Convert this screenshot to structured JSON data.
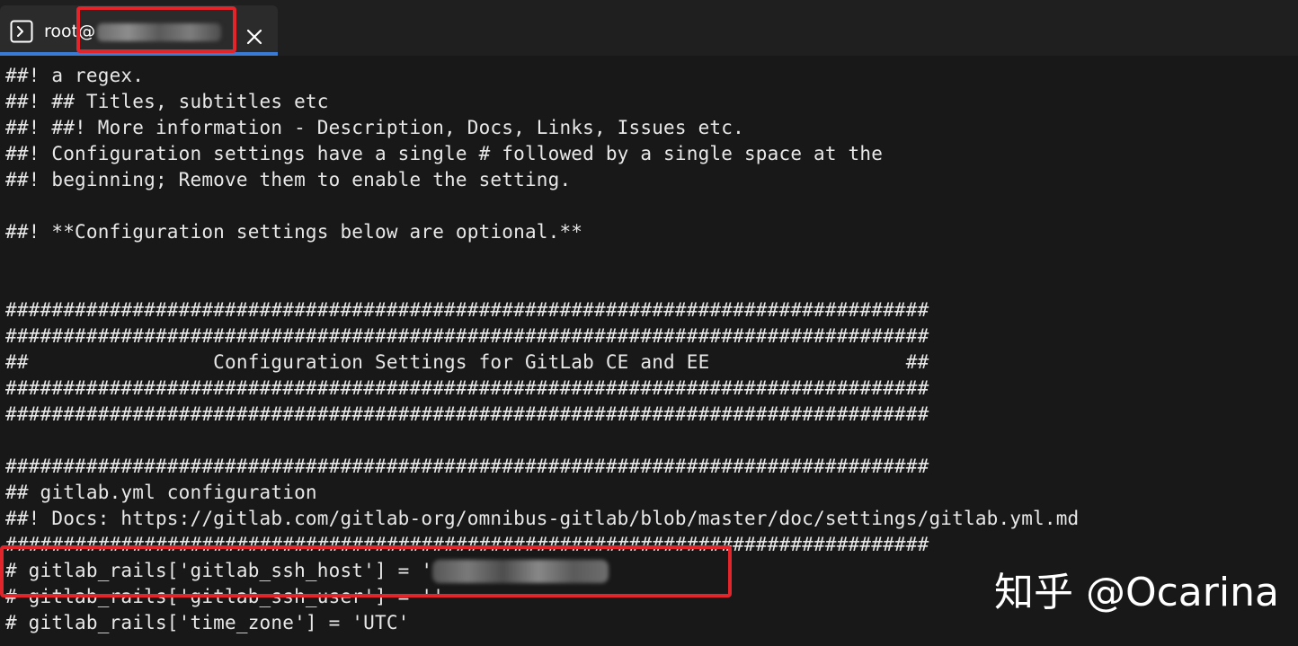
{
  "tab": {
    "title_prefix": "root@",
    "close_label": "×"
  },
  "terminal": {
    "lines": [
      "##! a regex.",
      "##! ## Titles, subtitles etc",
      "##! ##! More information - Description, Docs, Links, Issues etc.",
      "##! Configuration settings have a single # followed by a single space at the",
      "##! beginning; Remove them to enable the setting.",
      "",
      "##! **Configuration settings below are optional.**",
      "",
      "",
      "################################################################################",
      "################################################################################",
      "##                Configuration Settings for GitLab CE and EE                 ##",
      "################################################################################",
      "################################################################################",
      "",
      "################################################################################",
      "## gitlab.yml configuration",
      "##! Docs: https://gitlab.com/gitlab-org/omnibus-gitlab/blob/master/doc/settings/gitlab.yml.md",
      "################################################################################",
      "# gitlab_rails['gitlab_ssh_host'] = '",
      "# gitlab_rails['gitlab_ssh_user'] = ''",
      "# gitlab_rails['time_zone'] = 'UTC'"
    ]
  },
  "watermark": "知乎 @Ocarina",
  "colors": {
    "background": "#181818",
    "tab_background": "#2b2b2b",
    "tab_accent": "#3a7bd5",
    "annotation_red": "#e2242b",
    "text": "#e8e8e8"
  },
  "icons": {
    "terminal": "terminal-prompt-icon",
    "close": "close-icon"
  }
}
